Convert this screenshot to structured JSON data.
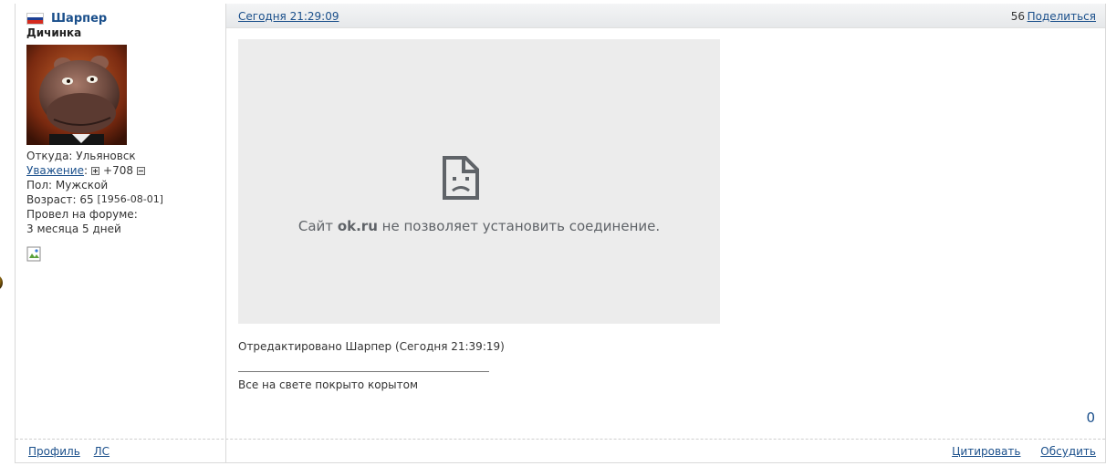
{
  "author": {
    "name": "Шарпер",
    "title": "Дичинка",
    "flag_colors": [
      "#ffffff",
      "#1c3f94",
      "#d52b1e"
    ],
    "location": "Откуда: Ульяновск",
    "reputation_label": "Уважение",
    "reputation_value": "+708",
    "gender": "Пол: Мужской",
    "age": "Возраст: 65",
    "birthdate": "[1956-08-01]",
    "forum_time_label": "Провел на форуме:",
    "forum_time_value": "3 месяца 5 дней"
  },
  "post": {
    "date": "Сегодня 21:29:09",
    "number": "56",
    "share_label": "Поделиться",
    "embed": {
      "message_prefix": "Сайт",
      "message_site": "ok.ru",
      "message_suffix": "не позволяет установить соединение.",
      "background": "#ececec"
    },
    "edited_note": "Отредактировано Шарпер (Сегодня 21:39:19)",
    "signature": "Все на свете покрыто корытом",
    "rating": "0"
  },
  "footer": {
    "profile_label": "Профиль",
    "pm_label": "ЛС",
    "quote_label": "Цитировать",
    "discuss_label": "Обсудить"
  },
  "colors": {
    "link": "#1a4f8b",
    "border": "#d9d9d9"
  }
}
